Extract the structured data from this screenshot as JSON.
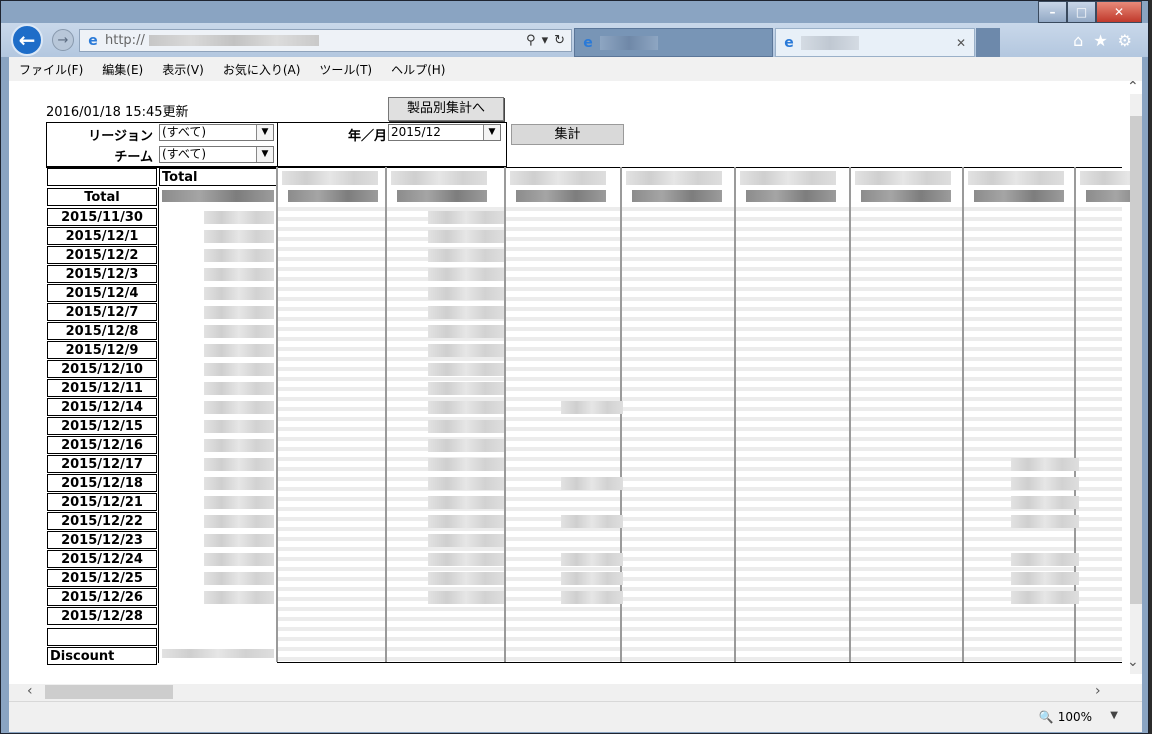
{
  "browser": {
    "url_prefix": "http://",
    "zoom": "100%"
  },
  "menu": [
    "ファイル(F)",
    "編集(E)",
    "表示(V)",
    "お気に入り(A)",
    "ツール(T)",
    "ヘルプ(H)"
  ],
  "page": {
    "updated": "2016/01/18 15:45更新",
    "product_button": "製品別集計へ",
    "region_label": "リージョン",
    "region_value": "(すべて)",
    "team_label": "チーム",
    "team_value": "(すべて)",
    "yearmonth_label": "年／月",
    "yearmonth_value": "2015/12",
    "aggregate_button": "集計",
    "total_col_header": "Total",
    "total_row": "Total",
    "discount_row": "Discount",
    "dates": [
      "2015/11/30",
      "2015/12/1",
      "2015/12/2",
      "2015/12/3",
      "2015/12/4",
      "2015/12/7",
      "2015/12/8",
      "2015/12/9",
      "2015/12/10",
      "2015/12/11",
      "2015/12/14",
      "2015/12/15",
      "2015/12/16",
      "2015/12/17",
      "2015/12/18",
      "2015/12/21",
      "2015/12/22",
      "2015/12/23",
      "2015/12/24",
      "2015/12/25",
      "2015/12/26",
      "2015/12/28"
    ]
  }
}
